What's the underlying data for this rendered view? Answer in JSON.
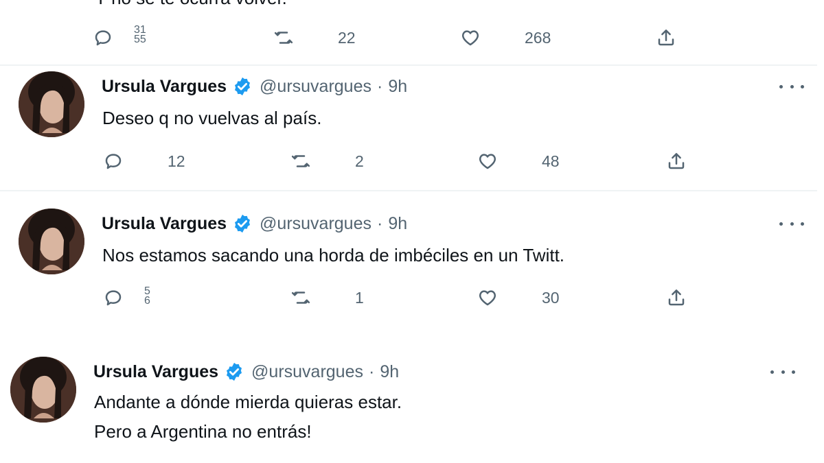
{
  "top_tweet": {
    "text": "Y no se te ocurra volver.",
    "replies": "31\n55",
    "retweets": "22",
    "likes": "268"
  },
  "tweets": [
    {
      "name": "Ursula Vargues",
      "handle": "@ursuvargues",
      "dot": "·",
      "time": "9h",
      "text": "Deseo q no vuelvas al país.",
      "replies": "12",
      "retweets": "2",
      "likes": "48"
    },
    {
      "name": "Ursula Vargues",
      "handle": "@ursuvargues",
      "dot": "·",
      "time": "9h",
      "text": "Nos estamos sacando una horda de imbéciles en un Twitt.",
      "replies": "5\n6",
      "retweets": "1",
      "likes": "30"
    },
    {
      "name": "Ursula Vargues",
      "handle": "@ursuvargues",
      "dot": "·",
      "time": "9h",
      "text_line1": "Andante a dónde mierda quieras estar.",
      "text_line2": "Pero a Argentina no entrás!"
    }
  ],
  "icons": {
    "reply": "reply-icon",
    "retweet": "retweet-icon",
    "like": "heart-icon",
    "share": "share-icon",
    "verified": "verified-badge-icon",
    "more": "more-icon"
  },
  "colors": {
    "verified": "#1d9bf0",
    "secondary_text": "#536471",
    "separator": "#eff3f4"
  }
}
